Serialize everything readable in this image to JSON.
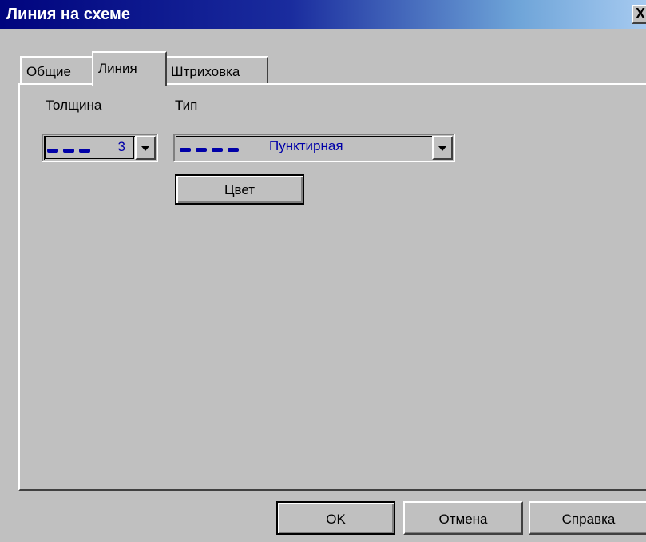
{
  "window": {
    "title": "Линия на схеме",
    "close_label": "X"
  },
  "tabs": [
    {
      "label": "Общие",
      "active": false
    },
    {
      "label": "Линия",
      "active": true
    },
    {
      "label": "Штриховка",
      "active": false
    }
  ],
  "thickness": {
    "label": "Толщина",
    "value": "3"
  },
  "type": {
    "label": "Тип",
    "value": "Пунктирная"
  },
  "color_button": {
    "label": "Цвет"
  },
  "footer": {
    "ok_label": "OK",
    "cancel_label": "Отмена",
    "help_label": "Справка"
  },
  "colors": {
    "value_text": "#0000a8",
    "title_bar": "#00047e",
    "face": "#c0c0c0"
  }
}
